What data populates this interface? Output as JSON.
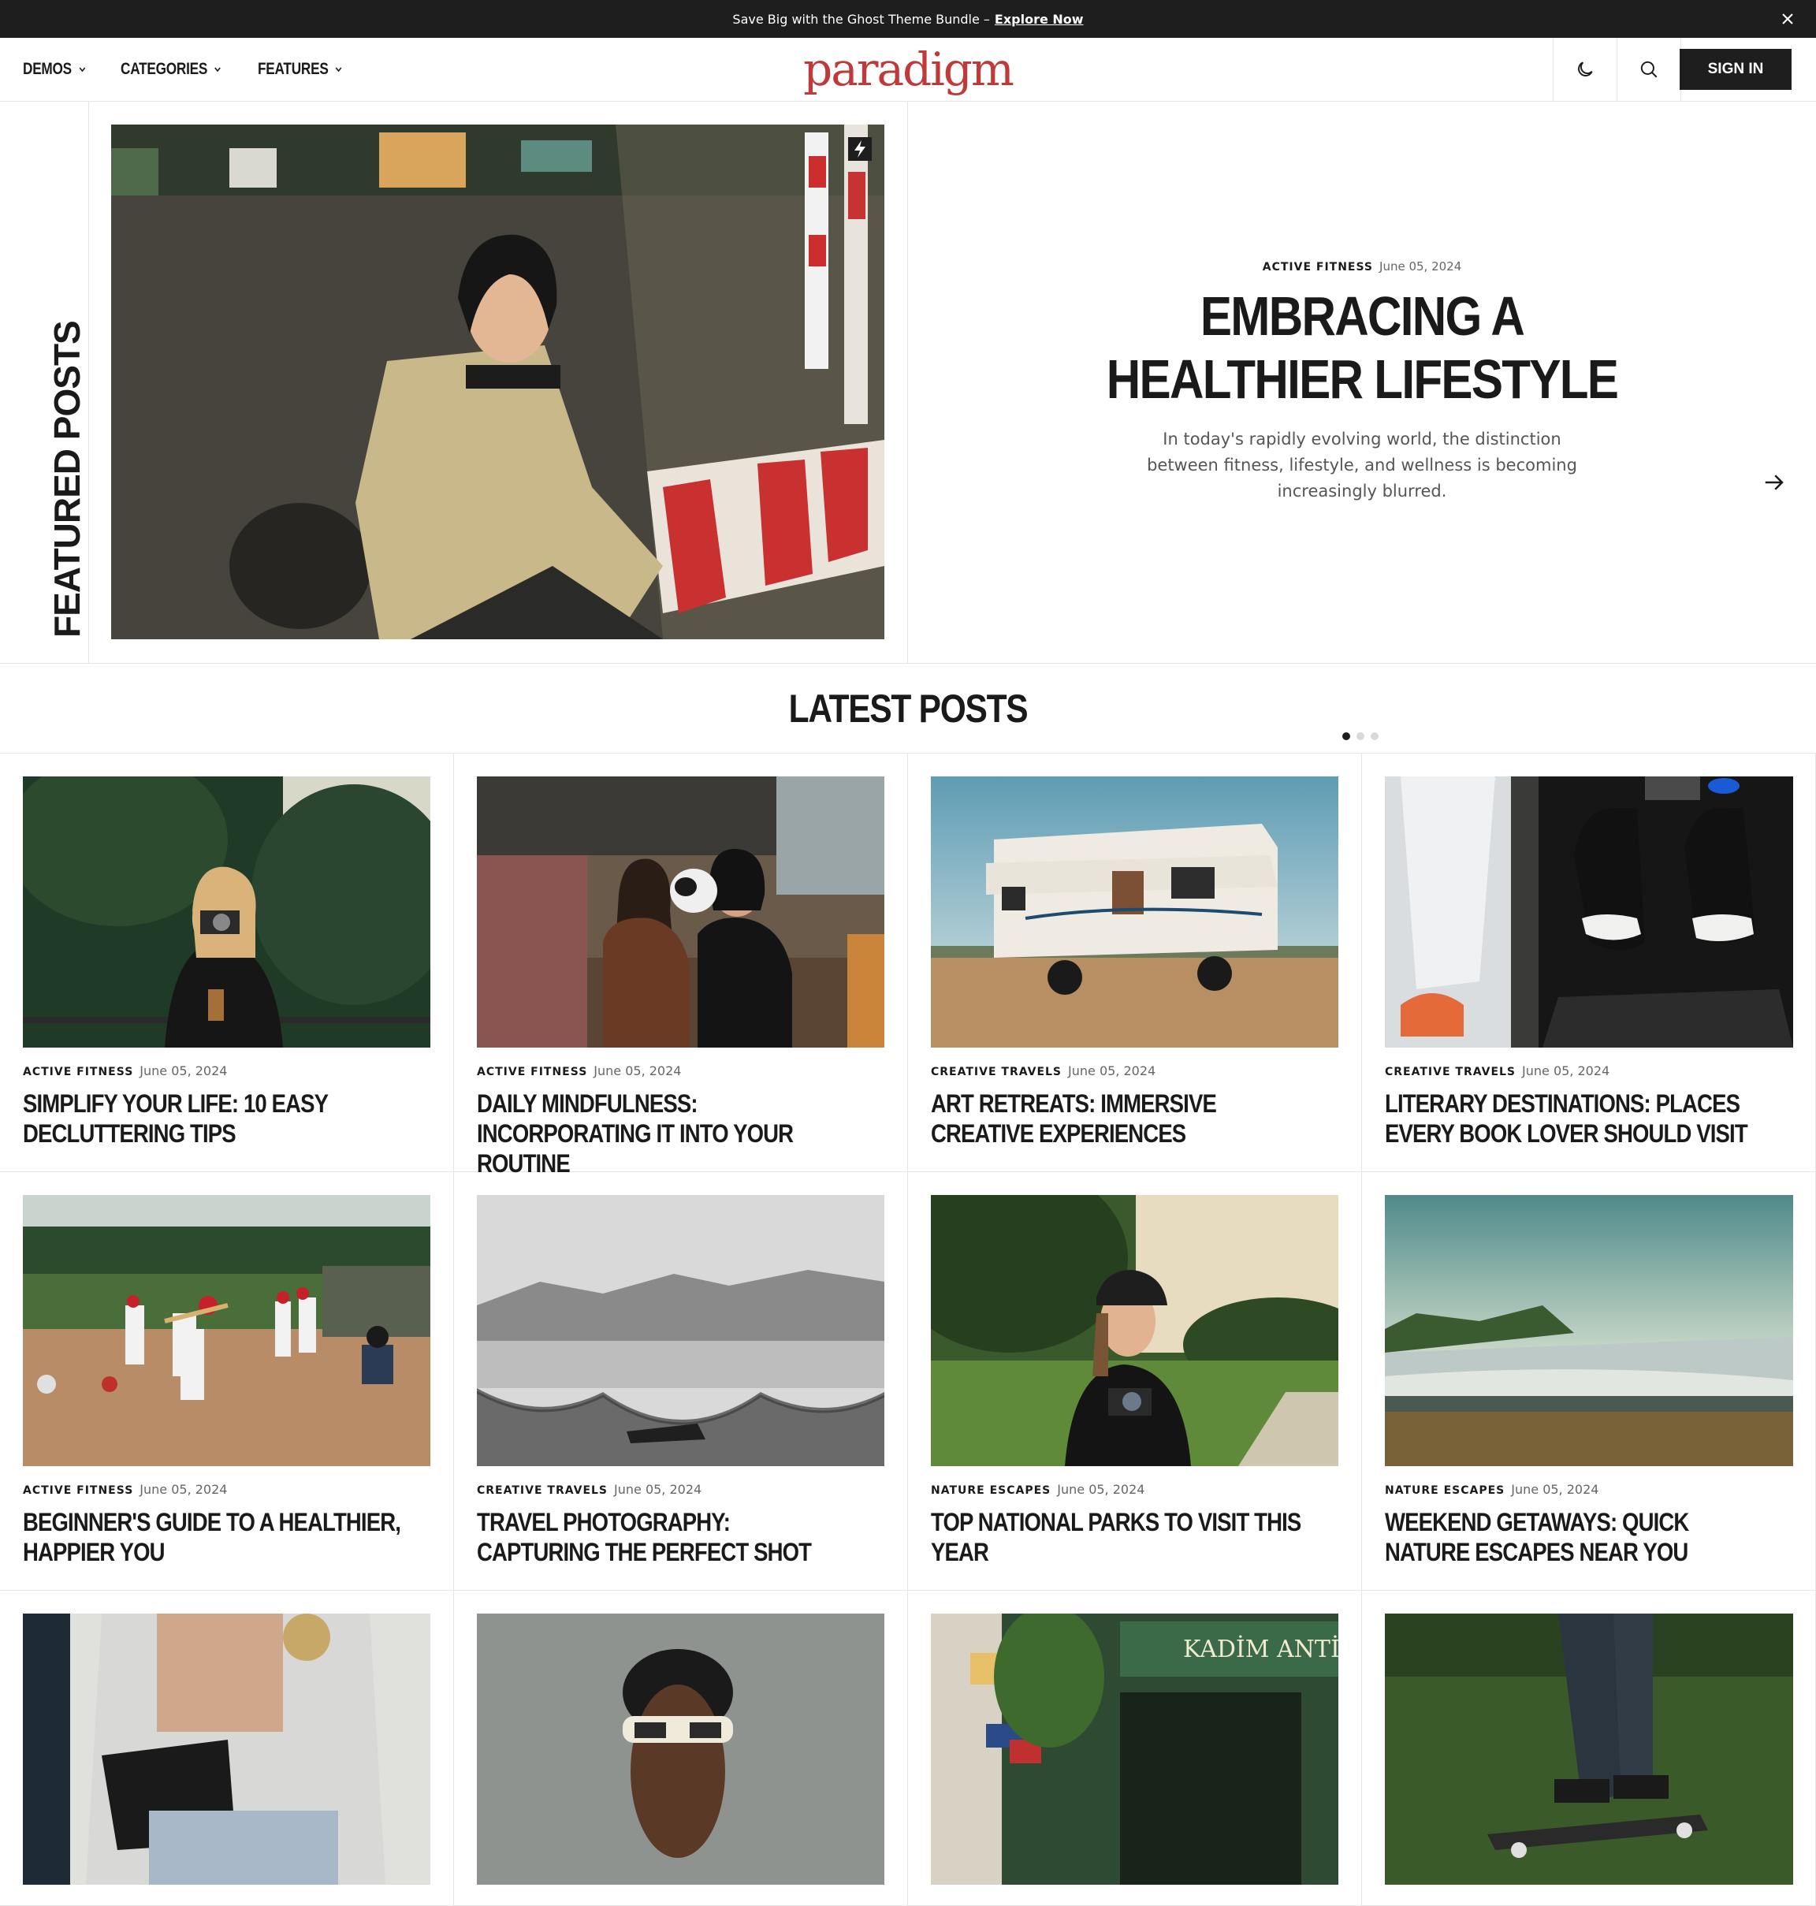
{
  "announcement": {
    "text": "Save Big with the Ghost Theme Bundle –",
    "link": "Explore Now"
  },
  "header": {
    "nav": [
      "DEMOS",
      "CATEGORIES",
      "FEATURES"
    ],
    "logo": "paradigm",
    "sign_in": "SIGN IN"
  },
  "featured": {
    "section_label": "FEATURED POSTS",
    "category": "ACTIVE FITNESS",
    "date": "June 05, 2024",
    "title": "EMBRACING A HEALTHIER LIFESTYLE",
    "excerpt": "In today's rapidly evolving world, the distinction between fitness, lifestyle, and wellness is becoming increasingly blurred.",
    "slide_count": 3,
    "active_slide": 1
  },
  "latest": {
    "heading": "LATEST POSTS",
    "posts": [
      {
        "category": "ACTIVE FITNESS",
        "date": "June 05, 2024",
        "title": "SIMPLIFY YOUR LIFE: 10 EASY DECLUTTERING TIPS"
      },
      {
        "category": "ACTIVE FITNESS",
        "date": "June 05, 2024",
        "title": "DAILY MINDFULNESS: INCORPORATING IT INTO YOUR ROUTINE"
      },
      {
        "category": "CREATIVE TRAVELS",
        "date": "June 05, 2024",
        "title": "ART RETREATS: IMMERSIVE CREATIVE EXPERIENCES"
      },
      {
        "category": "CREATIVE TRAVELS",
        "date": "June 05, 2024",
        "title": "LITERARY DESTINATIONS: PLACES EVERY BOOK LOVER SHOULD VISIT"
      },
      {
        "category": "ACTIVE FITNESS",
        "date": "June 05, 2024",
        "title": "BEGINNER'S GUIDE TO A HEALTHIER, HAPPIER YOU"
      },
      {
        "category": "CREATIVE TRAVELS",
        "date": "June 05, 2024",
        "title": "TRAVEL PHOTOGRAPHY: CAPTURING THE PERFECT SHOT"
      },
      {
        "category": "NATURE ESCAPES",
        "date": "June 05, 2024",
        "title": "TOP NATIONAL PARKS TO VISIT THIS YEAR"
      },
      {
        "category": "NATURE ESCAPES",
        "date": "June 05, 2024",
        "title": "WEEKEND GETAWAYS: QUICK NATURE ESCAPES NEAR YOU"
      },
      {
        "category": "",
        "date": "",
        "title": ""
      },
      {
        "category": "",
        "date": "",
        "title": ""
      },
      {
        "category": "",
        "date": "",
        "title": ""
      },
      {
        "category": "",
        "date": "",
        "title": ""
      }
    ]
  },
  "sign_text": {
    "shop": "KADİM ANTİKA"
  },
  "colors": {
    "logo": "#c03a3a",
    "dark": "#1e1e1e",
    "border": "#e5e5e5"
  },
  "icons": [
    "close-icon",
    "chevron-down-icon",
    "moon-icon",
    "search-icon",
    "arrow-right-icon",
    "lightning-icon"
  ]
}
